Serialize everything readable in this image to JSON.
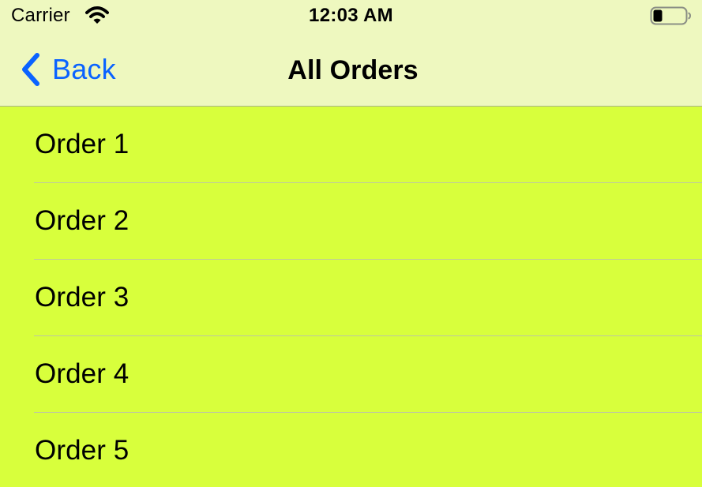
{
  "status_bar": {
    "carrier": "Carrier",
    "time": "12:03 AM",
    "icons": [
      "wifi-icon",
      "battery-icon"
    ]
  },
  "nav_bar": {
    "back_label": "Back",
    "title": "All Orders",
    "icons": [
      "chevron-left-icon"
    ]
  },
  "orders": [
    {
      "label": "Order 1"
    },
    {
      "label": "Order 2"
    },
    {
      "label": "Order 3"
    },
    {
      "label": "Order 4"
    },
    {
      "label": "Order 5"
    }
  ],
  "colors": {
    "top_bar_background": "#eef8bf",
    "list_background": "#d8ff3c",
    "accent": "#0a63ff",
    "separator": "#bec8a0"
  }
}
